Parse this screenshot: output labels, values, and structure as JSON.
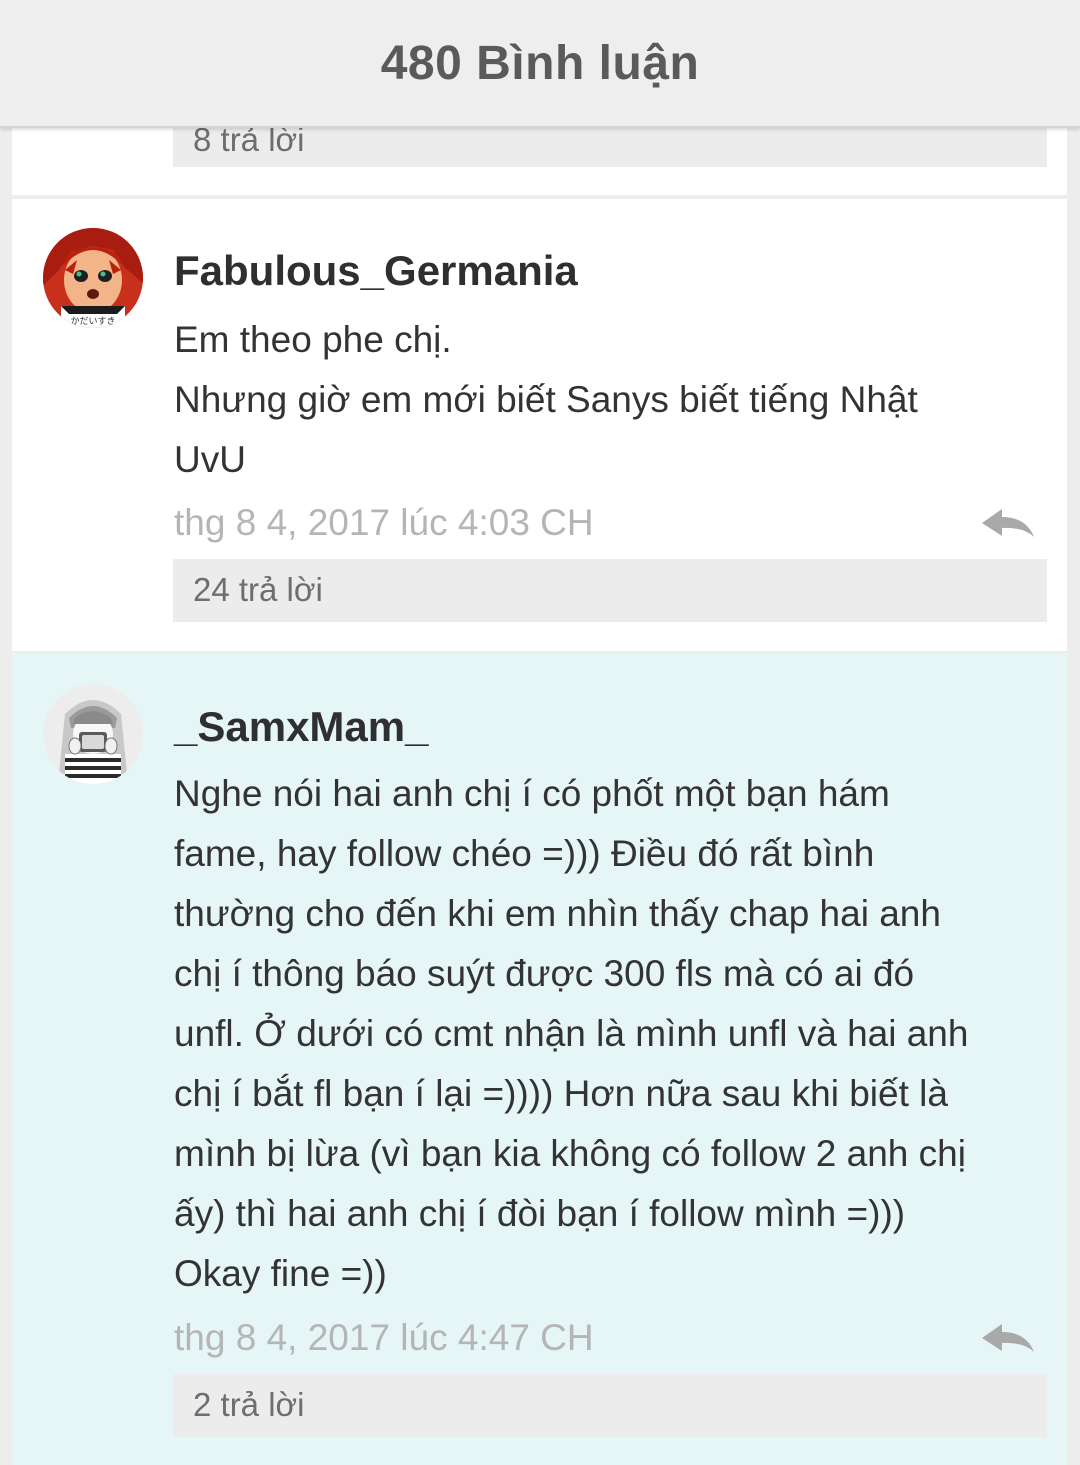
{
  "header": {
    "title": "480 Bình luận"
  },
  "previous_comment": {
    "replies_label": "8 trả lời"
  },
  "comments": [
    {
      "username": "Fabulous_Germania",
      "avatar_icon": "anime-avatar-red-hair-icon",
      "text_lines": [
        "Em theo phe chị.",
        "Nhưng giờ em mới biết Sanys biết tiếng Nhật",
        "UvU"
      ],
      "timestamp": "thg 8 4, 2017 lúc 4:03 CH",
      "replies_label": "24 trả lời",
      "highlighted": false
    },
    {
      "username": "_SamxMam_",
      "avatar_icon": "anime-avatar-girl-sketch-icon",
      "text_lines": [
        "Nghe nói hai anh chị í có phốt một bạn hám",
        "fame, hay follow chéo =))) Điều đó rất bình",
        "thường cho đến khi em nhìn thấy chap hai anh",
        "chị í thông báo suýt được 300 fls mà có ai đó",
        "unfl. Ở dưới có cmt nhận là mình unfl và hai anh",
        "chị í bắt fl bạn í lại =)))) Hơn nữa sau khi biết là",
        "mình bị lừa (vì bạn kia không có follow 2 anh chị",
        "ấy) thì hai anh chị í đòi bạn í follow mình =)))",
        "Okay fine =))"
      ],
      "timestamp": "thg 8 4, 2017 lúc 4:47 CH",
      "replies_label": "2 trả lời",
      "highlighted": true
    }
  ],
  "colors": {
    "header_bg": "#eeeeee",
    "header_text": "#5a5a5a",
    "highlight_bg": "#e6f5f6",
    "timestamp": "#b5b5b5",
    "replies_bar": "#ececec"
  }
}
